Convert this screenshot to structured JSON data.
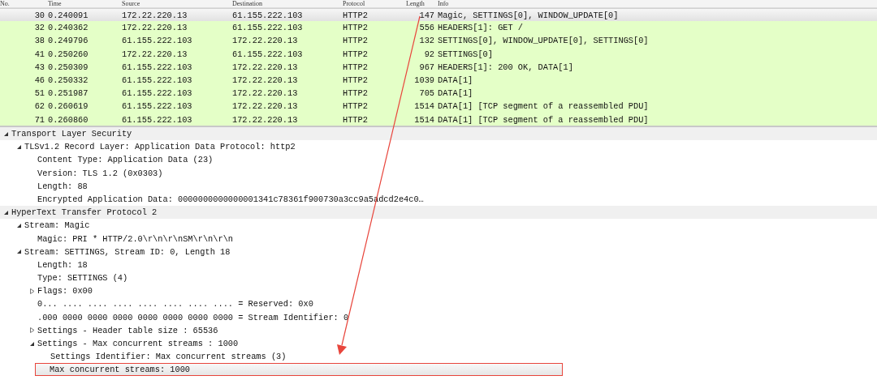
{
  "packet_list": {
    "columns": [
      "No.",
      "Time",
      "Source",
      "Destination",
      "Protocol",
      "Length",
      "Info"
    ],
    "rows": [
      {
        "no": "30",
        "time": "0.240091",
        "source": "172.22.220.13",
        "destination": "61.155.222.103",
        "protocol": "HTTP2",
        "length": "147",
        "info": "Magic, SETTINGS[0], WINDOW_UPDATE[0]",
        "selected": true
      },
      {
        "no": "32",
        "time": "0.240362",
        "source": "172.22.220.13",
        "destination": "61.155.222.103",
        "protocol": "HTTP2",
        "length": "556",
        "info": "HEADERS[1]: GET /",
        "selected": false
      },
      {
        "no": "38",
        "time": "0.249796",
        "source": "61.155.222.103",
        "destination": "172.22.220.13",
        "protocol": "HTTP2",
        "length": "132",
        "info": "SETTINGS[0], WINDOW_UPDATE[0], SETTINGS[0]",
        "selected": false
      },
      {
        "no": "41",
        "time": "0.250260",
        "source": "172.22.220.13",
        "destination": "61.155.222.103",
        "protocol": "HTTP2",
        "length": "92",
        "info": "SETTINGS[0]",
        "selected": false
      },
      {
        "no": "43",
        "time": "0.250309",
        "source": "61.155.222.103",
        "destination": "172.22.220.13",
        "protocol": "HTTP2",
        "length": "967",
        "info": "HEADERS[1]: 200 OK, DATA[1]",
        "selected": false
      },
      {
        "no": "46",
        "time": "0.250332",
        "source": "61.155.222.103",
        "destination": "172.22.220.13",
        "protocol": "HTTP2",
        "length": "1039",
        "info": "DATA[1]",
        "selected": false
      },
      {
        "no": "51",
        "time": "0.251987",
        "source": "61.155.222.103",
        "destination": "172.22.220.13",
        "protocol": "HTTP2",
        "length": "705",
        "info": "DATA[1]",
        "selected": false
      },
      {
        "no": "62",
        "time": "0.260619",
        "source": "61.155.222.103",
        "destination": "172.22.220.13",
        "protocol": "HTTP2",
        "length": "1514",
        "info": "DATA[1] [TCP segment of a reassembled PDU]",
        "selected": false
      },
      {
        "no": "71",
        "time": "0.260860",
        "source": "61.155.222.103",
        "destination": "172.22.220.13",
        "protocol": "HTTP2",
        "length": "1514",
        "info": "DATA[1] [TCP segment of a reassembled PDU]",
        "selected": false
      }
    ]
  },
  "detail_tree": [
    {
      "label": "Transport Layer Security",
      "expanded": true,
      "selected": false,
      "children": [
        {
          "label": "TLSv1.2 Record Layer: Application Data Protocol: http2",
          "expanded": true,
          "selected": false,
          "children": [
            {
              "label": "Content Type: Application Data (23)",
              "selected": false
            },
            {
              "label": "Version: TLS 1.2 (0x0303)",
              "selected": false
            },
            {
              "label": "Length: 88",
              "selected": false
            },
            {
              "label": "Encrypted Application Data: 0000000000000001341c78361f900730a3cc9a5adcd2e4c0…",
              "selected": false
            }
          ]
        }
      ]
    },
    {
      "label": "HyperText Transfer Protocol 2",
      "expanded": true,
      "selected": false,
      "children": [
        {
          "label": "Stream: Magic",
          "expanded": true,
          "selected": false,
          "children": [
            {
              "label": "Magic: PRI * HTTP/2.0\\r\\n\\r\\nSM\\r\\n\\r\\n",
              "selected": false
            }
          ]
        },
        {
          "label": "Stream: SETTINGS, Stream ID: 0, Length 18",
          "expanded": true,
          "selected": false,
          "children": [
            {
              "label": "Length: 18",
              "selected": false
            },
            {
              "label": "Type: SETTINGS (4)",
              "selected": false
            },
            {
              "label": "Flags: 0x00",
              "expanded": false,
              "selected": false
            },
            {
              "label": "0... .... .... .... .... .... .... .... = Reserved: 0x0",
              "selected": false
            },
            {
              "label": ".000 0000 0000 0000 0000 0000 0000 0000 = Stream Identifier: 0",
              "selected": false
            },
            {
              "label": "Settings - Header table size : 65536",
              "expanded": false,
              "selected": false
            },
            {
              "label": "Settings - Max concurrent streams : 1000",
              "expanded": true,
              "selected": false,
              "children": [
                {
                  "label": "Settings Identifier: Max concurrent streams (3)",
                  "selected": false
                },
                {
                  "label": "Max concurrent streams: 1000",
                  "selected": true
                }
              ]
            }
          ]
        }
      ]
    }
  ]
}
